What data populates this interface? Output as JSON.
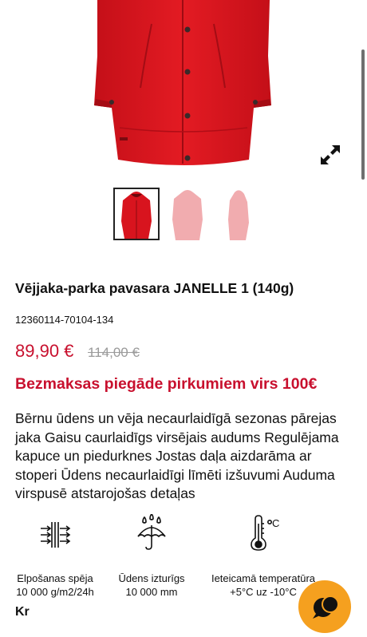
{
  "gallery": {
    "thumbnail_count": 3,
    "active_index": 0,
    "product_color": "#d8141e"
  },
  "product": {
    "title": "Vējjaka-parka pavasara JANELLE 1 (140g)",
    "sku": "12360114-70104-134",
    "price": "89,90 €",
    "old_price": "114,00 €",
    "shipping_promo": "Bezmaksas piegāde pirkumiem virs 100€",
    "description": "Bērnu ūdens un vēja necaurlaidīgā sezonas pārejas jaka Gaisu caurlaidīgs virsējais audums Regulējama kapuce un piedurknes Jostas daļa aizdarāma ar stoperi Ūdens necaurlaidīgi līmēti izšuvumi Auduma virspusē atstarojošas detaļas"
  },
  "features": [
    {
      "icon": "breathability-icon",
      "line1": "Elpošanas spēja",
      "line2": "10 000 g/m2/24h"
    },
    {
      "icon": "umbrella-rain-icon",
      "line1": "Ūdens izturīgs",
      "line2": "10 000 mm"
    },
    {
      "icon": "thermometer-icon",
      "line1": "Ieteicamā temperatūra",
      "line2": "+5°C uz -10°C"
    }
  ],
  "next_section": {
    "heading": "Kr"
  },
  "colors": {
    "accent": "#c8102e",
    "chat": "#f5a01f",
    "muted": "#9a9a9a"
  }
}
